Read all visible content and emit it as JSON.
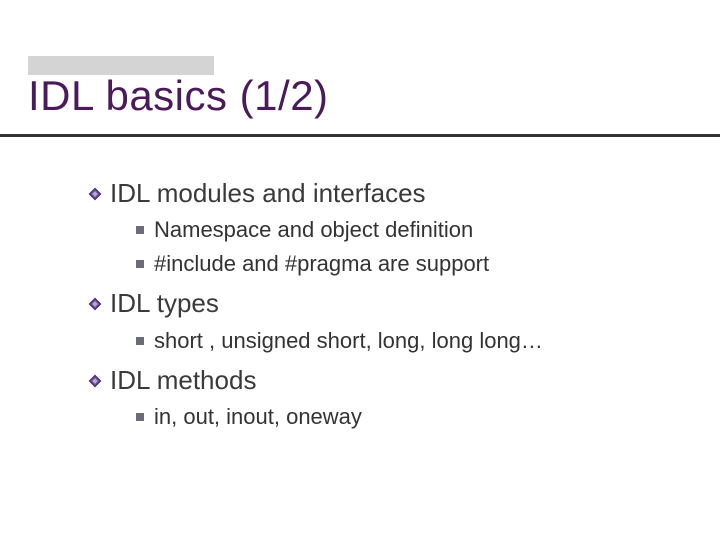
{
  "title": "IDL basics (1/2)",
  "sections": [
    {
      "heading": "IDL modules and interfaces",
      "items": [
        "Namespace and object definition",
        "#include and #pragma are support"
      ]
    },
    {
      "heading": "IDL types",
      "items": [
        "short , unsigned short, long, long long…"
      ]
    },
    {
      "heading": "IDL methods",
      "items": [
        "in, out, inout, oneway"
      ]
    }
  ]
}
